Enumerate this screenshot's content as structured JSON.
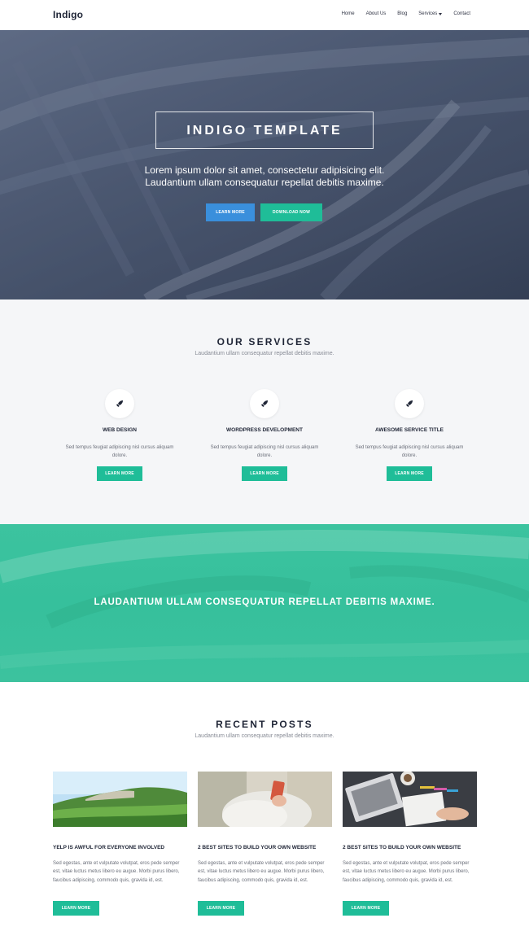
{
  "nav": {
    "brand": "Indigo",
    "items": [
      {
        "label": "Home"
      },
      {
        "label": "About Us"
      },
      {
        "label": "Blog"
      },
      {
        "label": "Services"
      },
      {
        "label": "Contact"
      }
    ]
  },
  "hero": {
    "title": "INDIGO TEMPLATE",
    "subtitle_line1": "Lorem ipsum dolor sit amet, consectetur adipisicing elit.",
    "subtitle_line2": "Laudantium ullam consequatur repellat debitis maxime.",
    "btn_primary": "LEARN MORE",
    "btn_secondary": "DOWNLOAD NOW"
  },
  "services": {
    "title": "OUR SERVICES",
    "subtitle": "Laudantium ullam consequatur repellat debitis maxime.",
    "items": [
      {
        "icon": "rocket-icon",
        "title": "WEB DESIGN",
        "text": "Sed tempus feugiat adipiscing nisl cursus aliquam dolore.",
        "button": "LEARN MORE"
      },
      {
        "icon": "rocket-icon",
        "title": "WORDPRESS DEVELOPMENT",
        "text": "Sed tempus feugiat adipiscing nisl cursus aliquam dolore.",
        "button": "LEARN MORE"
      },
      {
        "icon": "rocket-icon",
        "title": "AWESOME SERVICE TITLE",
        "text": "Sed tempus feugiat adipiscing nisl cursus aliquam dolore.",
        "button": "LEARN MORE"
      }
    ]
  },
  "banner": {
    "text": "LAUDANTIUM ULLAM CONSEQUATUR REPELLAT DEBITIS MAXIME."
  },
  "posts": {
    "title": "RECENT POSTS",
    "subtitle": "Laudantium ullam consequatur repellat debitis maxime.",
    "items": [
      {
        "title": "YELP IS AWFUL FOR EVERYONE INVOLVED",
        "text": "Sed egestas, ante et vulputate volutpat, eros pede semper est, vitae luctus metus libero eu augue. Morbi purus libero, faucibus adipiscing, commodo quis, gravida id, est.",
        "button": "LEARN MORE"
      },
      {
        "title": "2 BEST SITES TO BUILD YOUR OWN WEBSITE",
        "text": "Sed egestas, ante et vulputate volutpat, eros pede semper est, vitae luctus metus libero eu augue. Morbi purus libero, faucibus adipiscing, commodo quis, gravida id, est.",
        "button": "LEARN MORE"
      },
      {
        "title": "2 BEST SITES TO BUILD YOUR OWN WEBSITE",
        "text": "Sed egestas, ante et vulputate volutpat, eros pede semper est, vitae luctus metus libero eu augue. Morbi purus libero, faucibus adipiscing, commodo quis, gravida id, est.",
        "button": "LEARN MORE"
      }
    ]
  },
  "colors": {
    "accent_green": "#1fbd98",
    "accent_blue": "#3a8fdc",
    "hero_overlay": "#4c5a74",
    "banner_green": "#36c09c"
  }
}
